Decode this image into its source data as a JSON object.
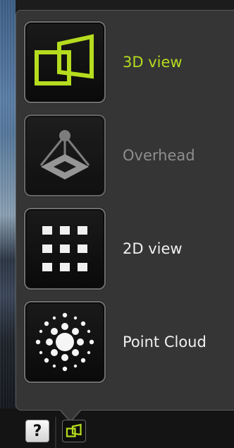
{
  "menu": {
    "items": [
      {
        "label": "3D view",
        "icon": "3d-view-icon",
        "state": "active"
      },
      {
        "label": "Overhead",
        "icon": "overhead-icon",
        "state": "disabled"
      },
      {
        "label": "2D view",
        "icon": "2d-view-icon",
        "state": "normal"
      },
      {
        "label": "Point Cloud",
        "icon": "point-cloud-icon",
        "state": "normal"
      }
    ]
  },
  "toolbar": {
    "help_label": "?",
    "view_button_icon": "3d-view-icon"
  },
  "colors": {
    "accent": "#b5dc1e",
    "disabled_text": "#8e8e8e",
    "panel": "#353535"
  }
}
